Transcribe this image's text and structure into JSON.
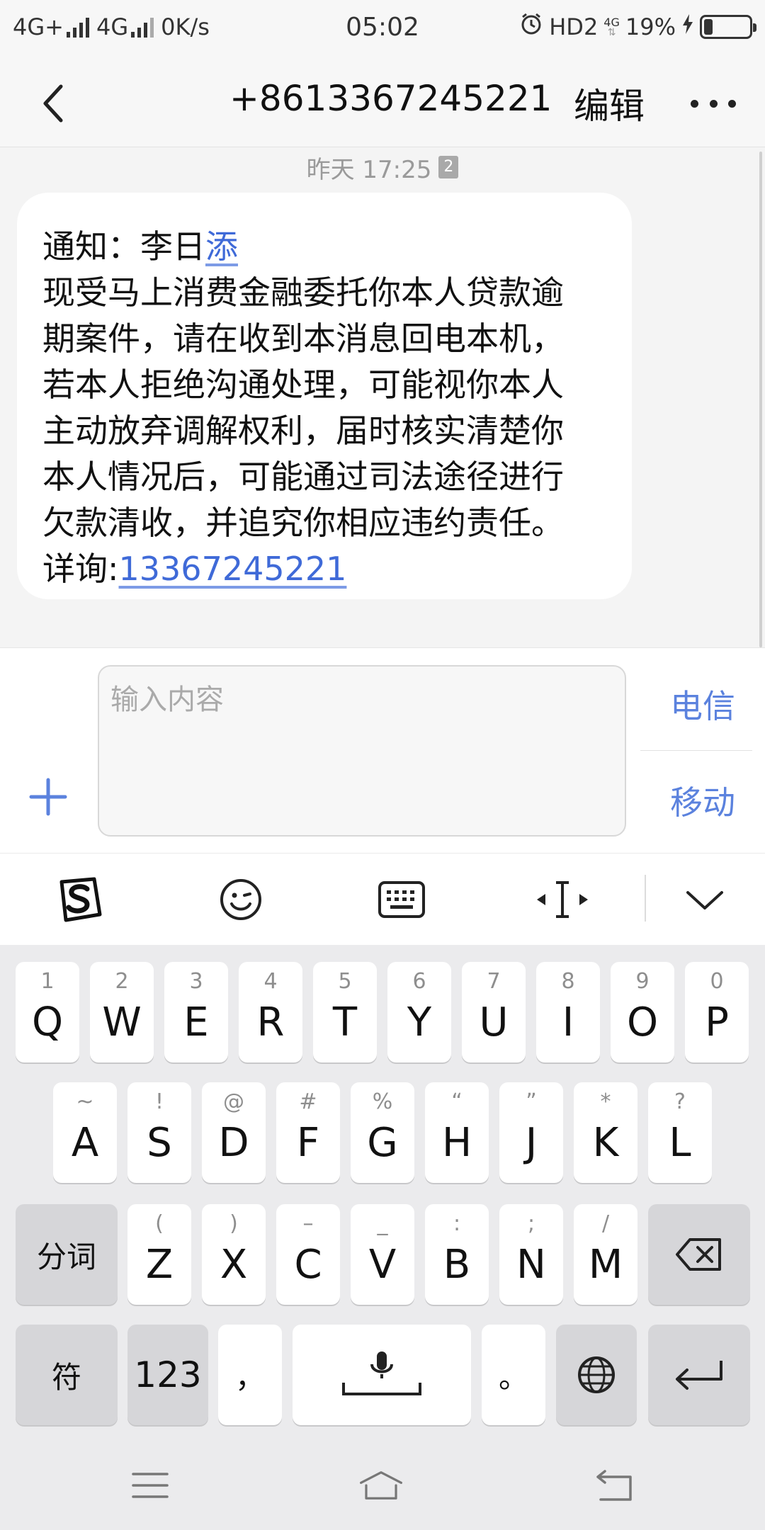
{
  "status_bar": {
    "network1": "4G+",
    "network2": "4G",
    "speed": "0K/s",
    "time": "05:02",
    "hd": "HD2",
    "hd_4g": "4G",
    "battery_percent": "19%",
    "battery_level": 0.19
  },
  "header": {
    "title": "+8613367245221",
    "edit_label": "编辑"
  },
  "conversation": {
    "timestamp": "昨天 17:25",
    "sim_badge": "2",
    "message": {
      "greeting_prefix": "通知：李日",
      "greeting_link": "添",
      "lines": [
        "现受马上消费金融委托你本人贷款逾",
        "期案件，请在收到本消息回电本机，",
        "若本人拒绝沟通处理，可能视你本人",
        "主动放弃调解权利，届时核实清楚你",
        "本人情况后，可能通过司法途径进行",
        "欠款清收，并追究你相应违约责任。"
      ],
      "detail_prefix": "详询:",
      "detail_phone": "13367245221"
    }
  },
  "compose": {
    "placeholder": "输入内容",
    "sim1_label": "电信",
    "sim2_label": "移动"
  },
  "keyboard": {
    "row1": [
      {
        "hint": "1",
        "key": "Q"
      },
      {
        "hint": "2",
        "key": "W"
      },
      {
        "hint": "3",
        "key": "E"
      },
      {
        "hint": "4",
        "key": "R"
      },
      {
        "hint": "5",
        "key": "T"
      },
      {
        "hint": "6",
        "key": "Y"
      },
      {
        "hint": "7",
        "key": "U"
      },
      {
        "hint": "8",
        "key": "I"
      },
      {
        "hint": "9",
        "key": "O"
      },
      {
        "hint": "0",
        "key": "P"
      }
    ],
    "row2": [
      {
        "hint": "~",
        "key": "A"
      },
      {
        "hint": "!",
        "key": "S"
      },
      {
        "hint": "@",
        "key": "D"
      },
      {
        "hint": "#",
        "key": "F"
      },
      {
        "hint": "%",
        "key": "G"
      },
      {
        "hint": "“",
        "key": "H"
      },
      {
        "hint": "”",
        "key": "J"
      },
      {
        "hint": "*",
        "key": "K"
      },
      {
        "hint": "?",
        "key": "L"
      }
    ],
    "row3": [
      {
        "hint": "(",
        "key": "Z"
      },
      {
        "hint": ")",
        "key": "X"
      },
      {
        "hint": "–",
        "key": "C"
      },
      {
        "hint": "_",
        "key": "V"
      },
      {
        "hint": ":",
        "key": "B"
      },
      {
        "hint": ";",
        "key": "N"
      },
      {
        "hint": "/",
        "key": "M"
      }
    ],
    "segment_label": "分词",
    "symbol_label": "符",
    "numeric_label": "123",
    "comma_label": "，",
    "period_label": "。"
  },
  "icons": {
    "accent_color": "#5b82de",
    "link_color": "#3f6ad8"
  }
}
